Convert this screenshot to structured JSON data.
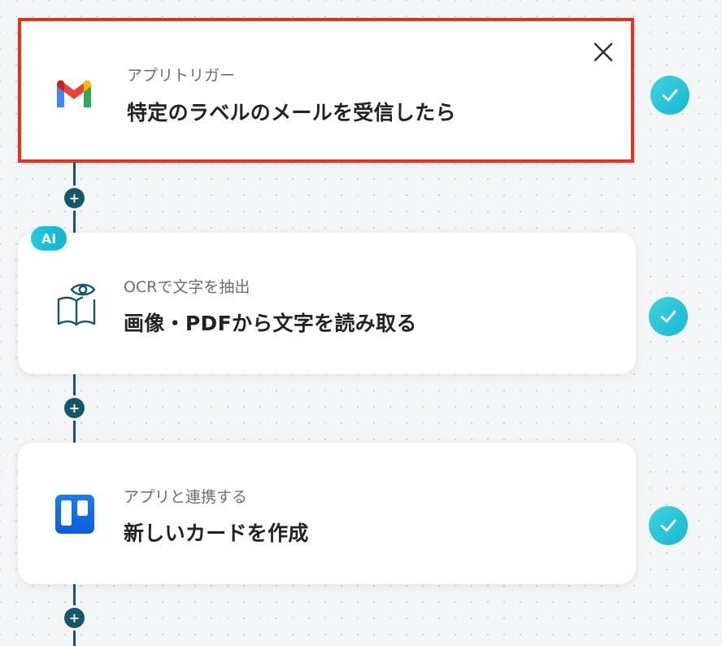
{
  "steps": [
    {
      "subtitle": "アプリトリガー",
      "title": "特定のラベルのメールを受信したら",
      "icon": "gmail-icon",
      "selected": true
    },
    {
      "badge": "AI",
      "subtitle": "OCRで文字を抽出",
      "title": "画像・PDFから文字を読み取る",
      "icon": "book-eye-icon"
    },
    {
      "subtitle": "アプリと連携する",
      "title": "新しいカードを作成",
      "icon": "trello-icon"
    }
  ],
  "add_button_symbol": "+",
  "colors": {
    "connector": "#14576b",
    "selected_outline": "#e8301e",
    "check": "#1fc3d8",
    "ai_badge": "#1ebfd6"
  }
}
